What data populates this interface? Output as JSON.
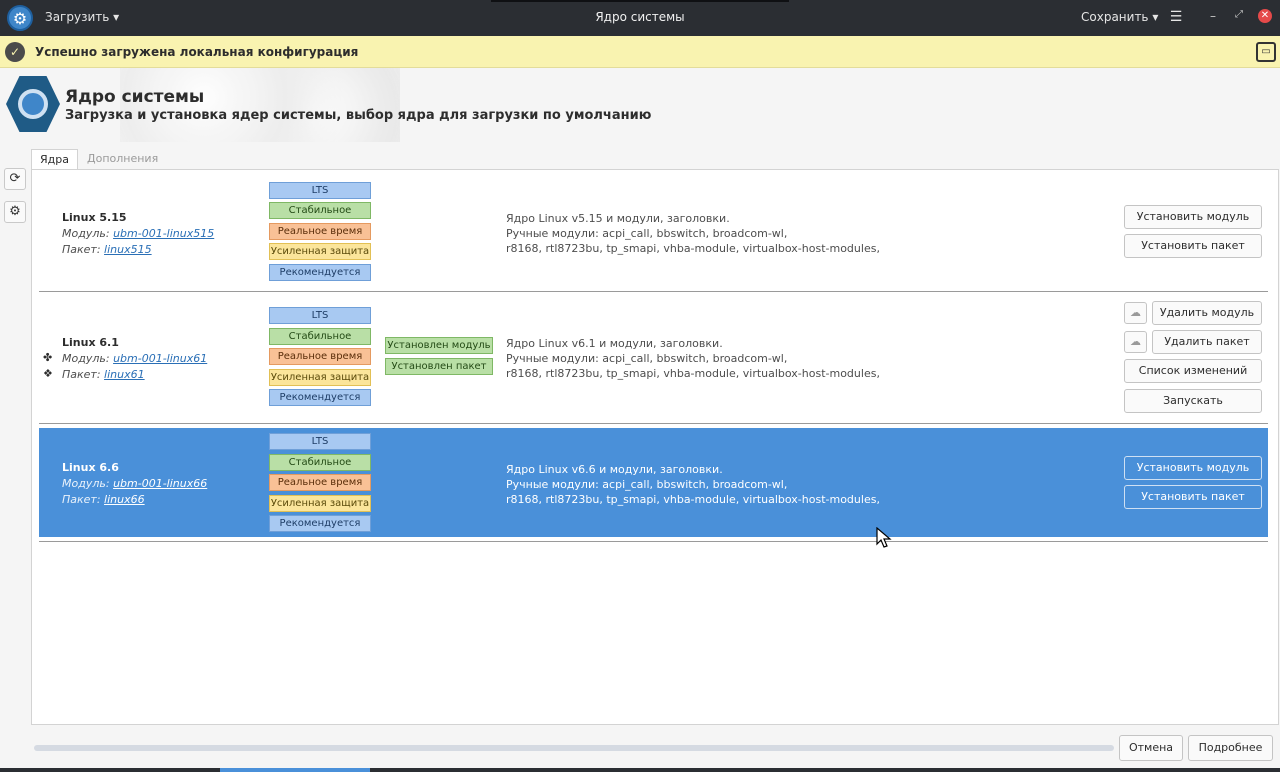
{
  "window": {
    "title": "Ядро системы",
    "menu_load": "Загрузить",
    "menu_save": "Сохранить"
  },
  "notification": {
    "message": "Успешно загружена локальная конфигурация"
  },
  "header": {
    "title": "Ядро системы",
    "subtitle": "Загрузка и установка ядер системы, выбор ядра для загрузки по умолчанию"
  },
  "tabs": [
    {
      "label": "Ядра",
      "active": true
    },
    {
      "label": "Дополнения",
      "active": false
    }
  ],
  "tag_labels": {
    "lts": "LTS",
    "stable": "Стабильное",
    "realtime": "Реальное время",
    "hardened": "Усиленная защита",
    "recommended": "Рекомендуется"
  },
  "kernels": [
    {
      "name": "Linux 5.15",
      "module_label": "Модуль:",
      "module": "ubm-001-linux515",
      "package_label": "Пакет:",
      "package": "linux515",
      "desc1": "Ядро Linux v5.15 и модули, заголовки.",
      "desc2": "Ручные модули: acpi_call, bbswitch, broadcom-wl,",
      "desc3": "r8168, rtl8723bu, tp_smapi, vhba-module, virtualbox-host-modules,",
      "btn1": "Установить модуль",
      "btn2": "Установить пакет"
    },
    {
      "name": "Linux 6.1",
      "module_label": "Модуль:",
      "module": "ubm-001-linux61",
      "package_label": "Пакет:",
      "package": "linux61",
      "installed_module": "Установлен модуль",
      "installed_package": "Установлен пакет",
      "desc1": "Ядро Linux v6.1 и модули, заголовки.",
      "desc2": "Ручные модули: acpi_call, bbswitch, broadcom-wl,",
      "desc3": "r8168, rtl8723bu, tp_smapi, vhba-module, virtualbox-host-modules,",
      "btn1": "Удалить модуль",
      "btn2": "Удалить пакет",
      "btn3": "Список изменений",
      "btn4": "Запускать"
    },
    {
      "name": "Linux 6.6",
      "module_label": "Модуль:",
      "module": "ubm-001-linux66",
      "package_label": "Пакет:",
      "package": "linux66",
      "desc1": "Ядро Linux v6.6 и модули, заголовки.",
      "desc2": "Ручные модули: acpi_call, bbswitch, broadcom-wl,",
      "desc3": "r8168, rtl8723bu, tp_smapi, vhba-module, virtualbox-host-modules,",
      "btn1": "Установить модуль",
      "btn2": "Установить пакет",
      "selected": true
    }
  ],
  "footer": {
    "cancel": "Отмена",
    "details": "Подробнее",
    "progress": 0
  },
  "colors": {
    "titlebar": "#2b2e33",
    "notification": "#f9f3b0",
    "selection": "#4a90d9"
  }
}
